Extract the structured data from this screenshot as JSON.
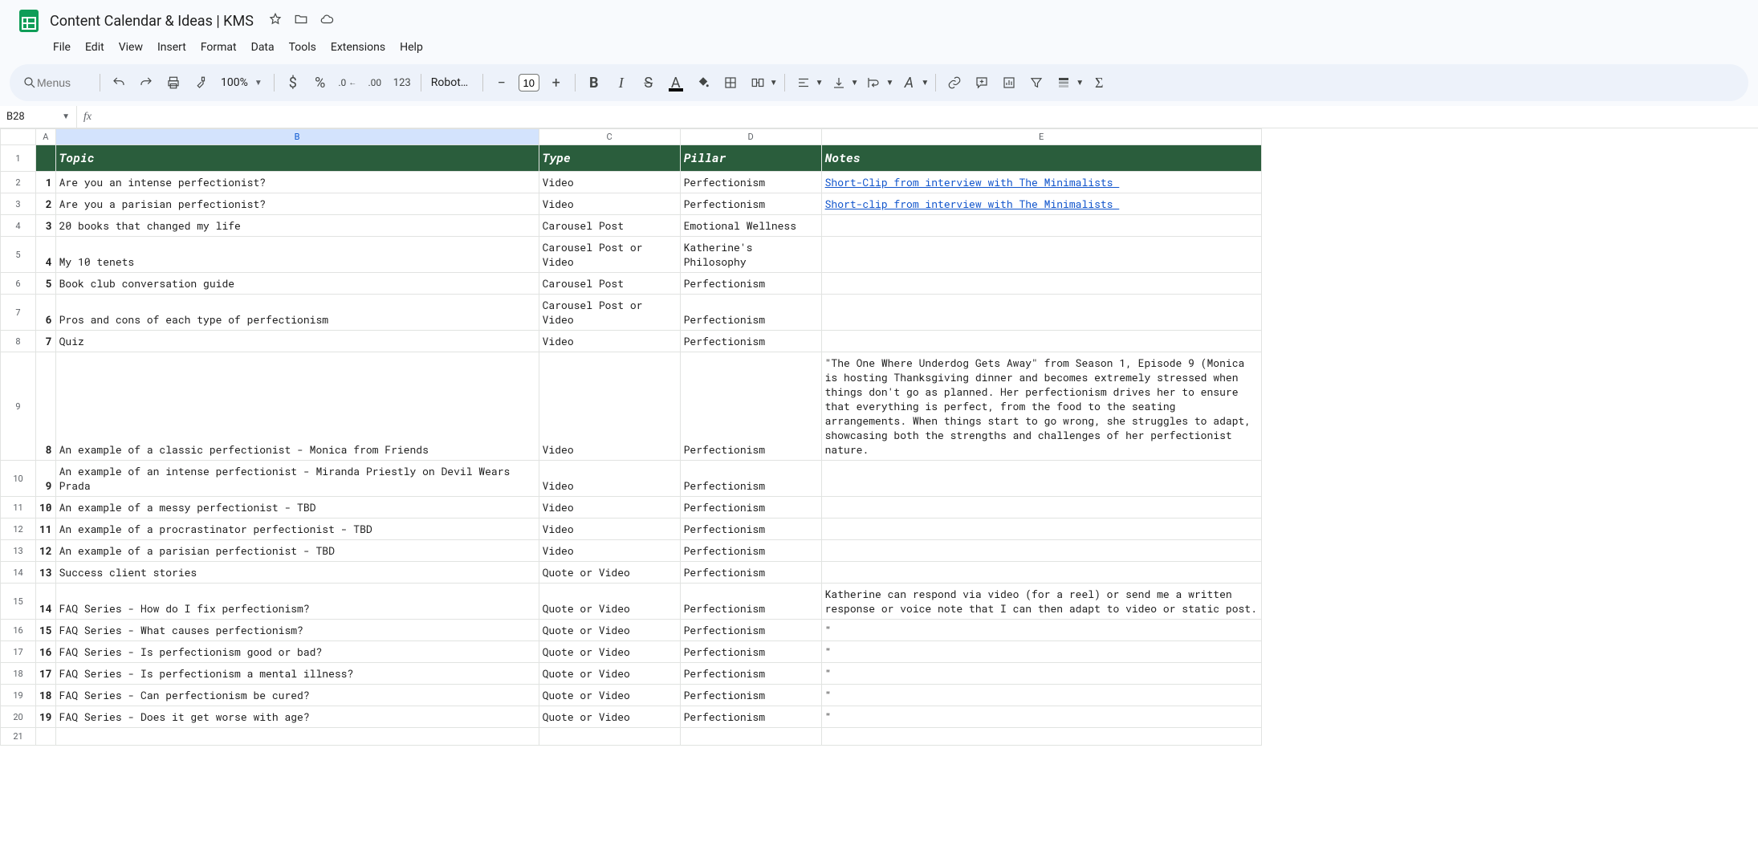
{
  "doc": {
    "title": "Content Calendar & Ideas | KMS"
  },
  "menus": [
    "File",
    "Edit",
    "View",
    "Insert",
    "Format",
    "Data",
    "Tools",
    "Extensions",
    "Help"
  ],
  "toolbar": {
    "search_placeholder": "Menus",
    "zoom": "100%",
    "font": "Robot…",
    "font_size": "10",
    "currency": "$",
    "percent": "%",
    "numfmt": "123"
  },
  "namebox": {
    "cell": "B28"
  },
  "columns": [
    "A",
    "B",
    "C",
    "D",
    "E"
  ],
  "header_row": {
    "A": "",
    "B": "Topic",
    "C": "Type",
    "D": "Pillar",
    "E": "Notes"
  },
  "rows": [
    {
      "n": "1",
      "topic": "Are you an intense perfectionist?",
      "type": "Video",
      "pillar": "Perfectionism",
      "notes": "Short-Clip from interview with The Minimalists ",
      "link": true
    },
    {
      "n": "2",
      "topic": "Are you a parisian perfectionist?",
      "type": "Video",
      "pillar": "Perfectionism",
      "notes": "Short-clip from interview with The Minimalists ",
      "link": true
    },
    {
      "n": "3",
      "topic": "20 books that changed my life",
      "type": "Carousel Post",
      "pillar": "Emotional Wellness",
      "notes": ""
    },
    {
      "n": "4",
      "topic": "My 10 tenets",
      "type": "Carousel Post or Video",
      "pillar": "Katherine's Philosophy",
      "notes": ""
    },
    {
      "n": "5",
      "topic": "Book club conversation guide",
      "type": "Carousel Post",
      "pillar": "Perfectionism",
      "notes": ""
    },
    {
      "n": "6",
      "topic": "Pros and cons of each type of perfectionism",
      "type": "Carousel Post or Video",
      "pillar": "Perfectionism",
      "notes": ""
    },
    {
      "n": "7",
      "topic": "Quiz",
      "type": "Video",
      "pillar": "Perfectionism",
      "notes": ""
    },
    {
      "n": "8",
      "topic": "An example of a classic perfectionist - Monica from Friends",
      "type": "Video",
      "pillar": "Perfectionism",
      "notes": "\"The One Where Underdog Gets Away\" from Season 1, Episode 9 (Monica is hosting Thanksgiving dinner and becomes extremely stressed when things don't go as planned. Her perfectionism drives her to ensure that everything is perfect, from the food to the seating arrangements. When things start to go wrong, she struggles to adapt, showcasing both the strengths and challenges of her perfectionist nature."
    },
    {
      "n": "9",
      "topic": "An example of an intense perfectionist - Miranda Priestly on Devil Wears Prada",
      "type": "Video",
      "pillar": "Perfectionism",
      "notes": ""
    },
    {
      "n": "10",
      "topic": "An example of a messy perfectionist - TBD",
      "type": "Video",
      "pillar": "Perfectionism",
      "notes": ""
    },
    {
      "n": "11",
      "topic": "An example of a procrastinator perfectionist - TBD",
      "type": "Video",
      "pillar": "Perfectionism",
      "notes": ""
    },
    {
      "n": "12",
      "topic": "An example of a parisian perfectionist - TBD",
      "type": "Video",
      "pillar": "Perfectionism",
      "notes": ""
    },
    {
      "n": "13",
      "topic": "Success client stories",
      "type": "Quote or Video",
      "pillar": "Perfectionism",
      "notes": ""
    },
    {
      "n": "14",
      "topic": "FAQ Series - How do I fix perfectionism?",
      "type": "Quote or Video",
      "pillar": "Perfectionism",
      "notes": "Katherine can respond via video (for a reel) or send me a written response or voice note that I can then adapt to video or static post."
    },
    {
      "n": "15",
      "topic": "FAQ Series - What causes perfectionism?",
      "type": "Quote or Video",
      "pillar": "Perfectionism",
      "notes": "\""
    },
    {
      "n": "16",
      "topic": "FAQ Series - Is perfectionism good or bad?",
      "type": "Quote or Video",
      "pillar": "Perfectionism",
      "notes": "\""
    },
    {
      "n": "17",
      "topic": "FAQ Series - Is perfectionism a mental illness?",
      "type": "Quote or Video",
      "pillar": "Perfectionism",
      "notes": "\""
    },
    {
      "n": "18",
      "topic": "FAQ Series - Can perfectionism be cured?",
      "type": "Quote or Video",
      "pillar": "Perfectionism",
      "notes": "\""
    },
    {
      "n": "19",
      "topic": "FAQ Series - Does it get worse with age?",
      "type": "Quote or Video",
      "pillar": "Perfectionism",
      "notes": "\""
    }
  ],
  "extra_row_count": 1
}
